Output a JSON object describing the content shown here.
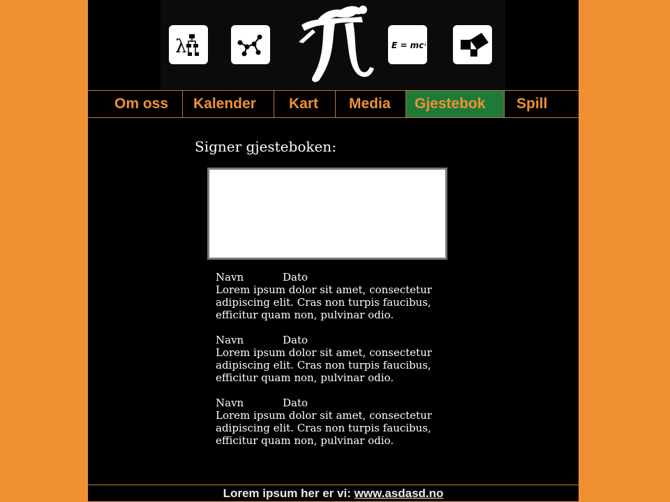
{
  "header": {
    "icons": [
      "lambda-flowchart-icon",
      "graph-icon",
      "pi-figure-icon",
      "emc2-icon",
      "pythagoras-icon"
    ],
    "emc2_text": "E = mc²",
    "lambda_text": "λ"
  },
  "nav": {
    "items": [
      {
        "label": "Om oss"
      },
      {
        "label": "Kalender"
      },
      {
        "label": "Kart"
      },
      {
        "label": "Media"
      },
      {
        "label": "Gjestebok",
        "active": true
      },
      {
        "label": "Spill"
      }
    ]
  },
  "main": {
    "title": "Signer gjesteboken:",
    "entries": [
      {
        "name": "Navn",
        "date": "Dato",
        "text": "Lorem ipsum dolor sit amet, consectetur adipiscing elit. Cras non turpis faucibus, efficitur quam non, pulvinar odio."
      },
      {
        "name": "Navn",
        "date": "Dato",
        "text": "Lorem ipsum dolor sit amet, consectetur adipiscing elit. Cras non turpis faucibus, efficitur quam non, pulvinar odio."
      },
      {
        "name": "Navn",
        "date": "Dato",
        "text": "Lorem ipsum dolor sit amet, consectetur adipiscing elit. Cras non turpis faucibus, efficitur quam non, pulvinar odio."
      }
    ]
  },
  "footer": {
    "text": "Lorem ipsum her er vi: ",
    "link": "www.asdasd.no"
  },
  "colors": {
    "background": "#ef9133",
    "page": "#000000",
    "nav_text": "#ef9133",
    "nav_active": "#1f7a3a"
  }
}
